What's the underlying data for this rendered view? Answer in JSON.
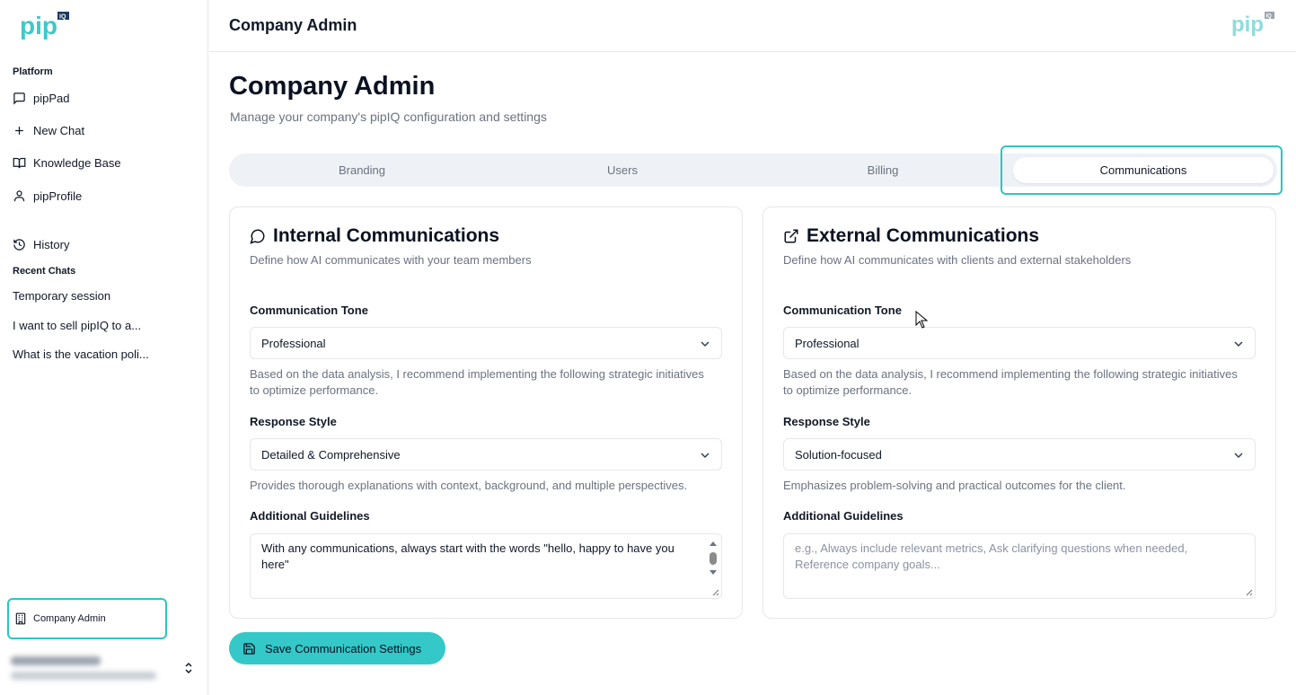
{
  "brand": {
    "accent": "#2ec4c4",
    "logo_text": "pip",
    "logo_badge": "IQ"
  },
  "sidebar": {
    "platform_label": "Platform",
    "nav": [
      {
        "label": "pipPad",
        "icon": "message-square-icon"
      },
      {
        "label": "New Chat",
        "icon": "plus-icon"
      },
      {
        "label": "Knowledge Base",
        "icon": "book-open-icon"
      },
      {
        "label": "pipProfile",
        "icon": "user-icon"
      }
    ],
    "history_label": "History",
    "recent_label": "Recent Chats",
    "recent": [
      "Temporary session",
      "I want to sell pipIQ to a...",
      "What is the vacation poli..."
    ],
    "company_admin": "Company Admin"
  },
  "header": {
    "title": "Company Admin"
  },
  "main": {
    "title": "Company Admin",
    "subtitle": "Manage your company's pipIQ configuration and settings",
    "tabs": [
      "Branding",
      "Users",
      "Billing",
      "Communications"
    ],
    "active_tab": "Communications",
    "internal": {
      "title": "Internal Communications",
      "desc": "Define how AI communicates with your team members",
      "tone_label": "Communication Tone",
      "tone_value": "Professional",
      "tone_help": "Based on the data analysis, I recommend implementing the following strategic initiatives to optimize performance.",
      "style_label": "Response Style",
      "style_value": "Detailed & Comprehensive",
      "style_help": "Provides thorough explanations with context, background, and multiple perspectives.",
      "guidelines_label": "Additional Guidelines",
      "guidelines_value": "With any communications, always start with the words \"hello, happy to have you here\""
    },
    "external": {
      "title": "External Communications",
      "desc": "Define how AI communicates with clients and external stakeholders",
      "tone_label": "Communication Tone",
      "tone_value": "Professional",
      "tone_help": "Based on the data analysis, I recommend implementing the following strategic initiatives to optimize performance.",
      "style_label": "Response Style",
      "style_value": "Solution-focused",
      "style_help": "Emphasizes problem-solving and practical outcomes for the client.",
      "guidelines_label": "Additional Guidelines",
      "guidelines_placeholder": "e.g., Always include relevant metrics, Ask clarifying questions when needed, Reference company goals..."
    },
    "save_label": "Save Communication Settings"
  }
}
